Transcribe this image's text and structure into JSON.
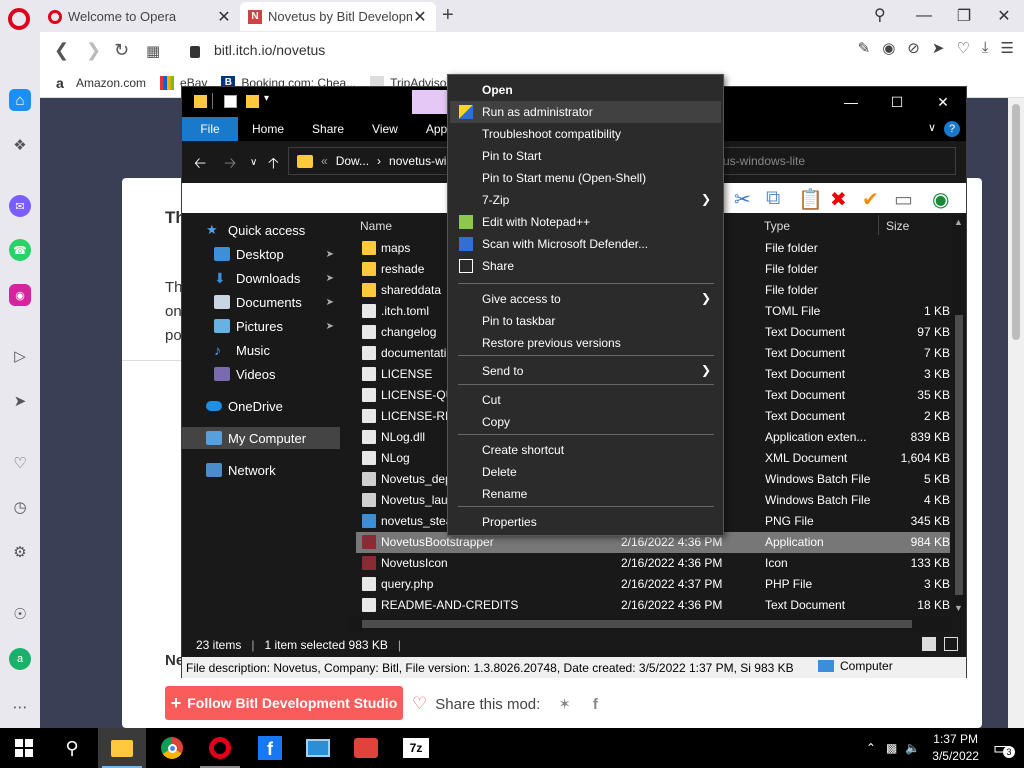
{
  "browser": {
    "tabs": [
      {
        "title": "Welcome to Opera",
        "close": "✕"
      },
      {
        "title": "Novetus by Bitl Developme",
        "close": "✕"
      }
    ],
    "new_tab": "+",
    "url": "bitl.itch.io/novetus",
    "bookmarks": [
      {
        "label": "Amazon.com"
      },
      {
        "label": "eBay"
      },
      {
        "label": "Booking.com: Chea..."
      },
      {
        "label": "TripAdviso"
      }
    ]
  },
  "page": {
    "frag_heading": "Th",
    "frag_l1": "Th",
    "frag_l2": "on",
    "frag_l3": "po",
    "frag_ne": "Ne",
    "follow_button": "Follow Bitl Development Studio",
    "share_label": "Share this mod:"
  },
  "explorer": {
    "ribbon_tabs": [
      "File",
      "Home",
      "Share",
      "View",
      "App"
    ],
    "path": {
      "prefix": "«",
      "seg1": "Dow...",
      "sep": "›",
      "seg2": "novetus-win"
    },
    "search_text": "us-windows-lite",
    "nav": [
      {
        "label": "Quick access",
        "icon": "star-icon"
      },
      {
        "label": "Desktop",
        "icon": "desktop-icon",
        "pinned": true
      },
      {
        "label": "Downloads",
        "icon": "download-icon",
        "pinned": true
      },
      {
        "label": "Documents",
        "icon": "documents-icon",
        "pinned": true
      },
      {
        "label": "Pictures",
        "icon": "pictures-icon",
        "pinned": true
      },
      {
        "label": "Music",
        "icon": "music-icon"
      },
      {
        "label": "Videos",
        "icon": "videos-icon"
      },
      {
        "label": "OneDrive",
        "icon": "cloud-icon"
      },
      {
        "label": "My Computer",
        "icon": "computer-icon"
      },
      {
        "label": "Network",
        "icon": "network-icon"
      }
    ],
    "columns": {
      "name": "Name",
      "type": "Type",
      "size": "Size"
    },
    "files": [
      {
        "name": "maps",
        "date": "",
        "type": "File folder",
        "size": "",
        "kind": "folder"
      },
      {
        "name": "reshade",
        "date": "",
        "type": "File folder",
        "size": "",
        "kind": "folder"
      },
      {
        "name": "shareddata",
        "date": "",
        "type": "File folder",
        "size": "",
        "kind": "folder"
      },
      {
        "name": ".itch.toml",
        "date": "",
        "type": "TOML File",
        "size": "1 KB",
        "kind": "file"
      },
      {
        "name": "changelog",
        "date": "",
        "type": "Text Document",
        "size": "97 KB",
        "kind": "file"
      },
      {
        "name": "documentati",
        "date": "",
        "type": "Text Document",
        "size": "7 KB",
        "kind": "file"
      },
      {
        "name": "LICENSE",
        "date": "",
        "type": "Text Document",
        "size": "3 KB",
        "kind": "file"
      },
      {
        "name": "LICENSE-QU",
        "date": "",
        "type": "Text Document",
        "size": "35 KB",
        "kind": "file"
      },
      {
        "name": "LICENSE-RES",
        "date": "",
        "type": "Text Document",
        "size": "2 KB",
        "kind": "file"
      },
      {
        "name": "NLog.dll",
        "date": "",
        "type": "Application exten...",
        "size": "839 KB",
        "kind": "file"
      },
      {
        "name": "NLog",
        "date": "",
        "type": "XML Document",
        "size": "1,604 KB",
        "kind": "file"
      },
      {
        "name": "Novetus_dep",
        "date": "",
        "type": "Windows Batch File",
        "size": "5 KB",
        "kind": "batch"
      },
      {
        "name": "Novetus_lau",
        "date": "",
        "type": "Windows Batch File",
        "size": "4 KB",
        "kind": "batch"
      },
      {
        "name": "novetus_stea",
        "date": "",
        "type": "PNG File",
        "size": "345 KB",
        "kind": "image"
      },
      {
        "name": "NovetusBootstrapper",
        "date": "2/16/2022 4:36 PM",
        "type": "Application",
        "size": "984 KB",
        "kind": "app"
      },
      {
        "name": "NovetusIcon",
        "date": "2/16/2022 4:36 PM",
        "type": "Icon",
        "size": "133 KB",
        "kind": "app"
      },
      {
        "name": "query.php",
        "date": "2/16/2022 4:37 PM",
        "type": "PHP File",
        "size": "3 KB",
        "kind": "file"
      },
      {
        "name": "README-AND-CREDITS",
        "date": "2/16/2022 4:36 PM",
        "type": "Text Document",
        "size": "18 KB",
        "kind": "file"
      }
    ],
    "selected_index": 14,
    "status": {
      "count": "23 items",
      "selection": "1 item selected  983 KB"
    },
    "description": "File description: Novetus, Company: Bitl, File version: 1.3.8026.20748, Date created: 3/5/2022 1:37 PM, Si 983 KB",
    "computer_label": "Computer"
  },
  "context_menu": {
    "items": [
      {
        "label": "Open",
        "bold": true
      },
      {
        "label": "Run as administrator",
        "icon": "shield-uac-icon",
        "highlight": true
      },
      {
        "label": "Troubleshoot compatibility"
      },
      {
        "label": "Pin to Start"
      },
      {
        "label": "Pin to Start menu (Open-Shell)"
      },
      {
        "label": "7-Zip",
        "submenu": true
      },
      {
        "label": "Edit with Notepad++",
        "icon": "notepad-icon"
      },
      {
        "label": "Scan with Microsoft Defender...",
        "icon": "defender-icon"
      },
      {
        "label": "Share",
        "icon": "share-icon"
      },
      {
        "label": "Give access to",
        "submenu": true
      },
      {
        "label": "Pin to taskbar"
      },
      {
        "label": "Restore previous versions"
      },
      {
        "label": "Send to",
        "submenu": true
      },
      {
        "label": "Cut"
      },
      {
        "label": "Copy"
      },
      {
        "label": "Create shortcut"
      },
      {
        "label": "Delete"
      },
      {
        "label": "Rename"
      },
      {
        "label": "Properties"
      }
    ]
  },
  "taskbar": {
    "time": "1:37 PM",
    "date": "3/5/2022",
    "notif_count": "3"
  }
}
